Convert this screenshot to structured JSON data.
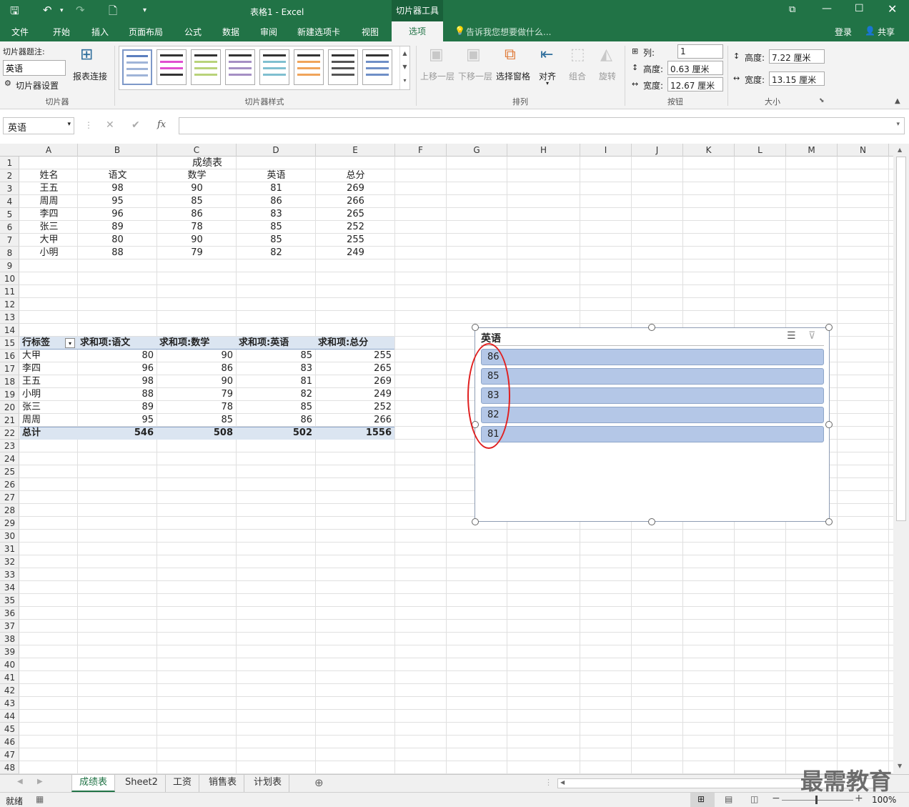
{
  "window": {
    "title": "表格1 - Excel",
    "context_tab": "切片器工具"
  },
  "ribbon_tabs": [
    "文件",
    "开始",
    "插入",
    "页面布局",
    "公式",
    "数据",
    "审阅",
    "新建选项卡",
    "视图",
    "选项"
  ],
  "tell_me": "告诉我您想要做什么...",
  "login": "登录",
  "share": "共享",
  "ribbon": {
    "caption_label": "切片器题注:",
    "caption_value": "英语",
    "slicer_settings": "切片器设置",
    "report_conn": "报表连接",
    "group_slicer": "切片器",
    "group_styles": "切片器样式",
    "bring_forward": "上移一层",
    "send_backward": "下移一层",
    "selection_pane": "选择窗格",
    "align": "对齐",
    "group": "组合",
    "rotate": "旋转",
    "group_arrange": "排列",
    "columns_label": "列:",
    "columns_value": "1",
    "btn_height_label": "高度:",
    "btn_height_value": "0.63 厘米",
    "btn_width_label": "宽度:",
    "btn_width_value": "12.67 厘米",
    "group_buttons": "按钮",
    "size_height_label": "高度:",
    "size_height_value": "7.22 厘米",
    "size_width_label": "宽度:",
    "size_width_value": "13.15 厘米",
    "group_size": "大小"
  },
  "namebox": "英语",
  "columns": [
    "A",
    "B",
    "C",
    "D",
    "E",
    "F",
    "G",
    "H",
    "I",
    "J",
    "K",
    "L",
    "M",
    "N"
  ],
  "table1": {
    "title": "成绩表",
    "headers": [
      "姓名",
      "语文",
      "数学",
      "英语",
      "总分"
    ],
    "rows": [
      [
        "王五",
        "98",
        "90",
        "81",
        "269"
      ],
      [
        "周周",
        "95",
        "85",
        "86",
        "266"
      ],
      [
        "李四",
        "96",
        "86",
        "83",
        "265"
      ],
      [
        "张三",
        "89",
        "78",
        "85",
        "252"
      ],
      [
        "大甲",
        "80",
        "90",
        "85",
        "255"
      ],
      [
        "小明",
        "88",
        "79",
        "82",
        "249"
      ]
    ]
  },
  "pivot": {
    "headers": [
      "行标签",
      "求和项:语文",
      "求和项:数学",
      "求和项:英语",
      "求和项:总分"
    ],
    "rows": [
      [
        "大甲",
        "80",
        "90",
        "85",
        "255"
      ],
      [
        "李四",
        "96",
        "86",
        "83",
        "265"
      ],
      [
        "王五",
        "98",
        "90",
        "81",
        "269"
      ],
      [
        "小明",
        "88",
        "79",
        "82",
        "249"
      ],
      [
        "张三",
        "89",
        "78",
        "85",
        "252"
      ],
      [
        "周周",
        "95",
        "85",
        "86",
        "266"
      ]
    ],
    "total": [
      "总计",
      "546",
      "508",
      "502",
      "1556"
    ]
  },
  "slicer": {
    "title": "英语",
    "items": [
      "86",
      "85",
      "83",
      "82",
      "81"
    ]
  },
  "sheets": [
    "成绩表",
    "Sheet2",
    "工资",
    "销售表",
    "计划表"
  ],
  "status": {
    "ready": "就绪",
    "zoom": "100%"
  },
  "watermark": "最需教育",
  "colors": {
    "excel_green": "#217346",
    "slicer_item": "#b4c7e7",
    "highlight_circle": "#e02020"
  }
}
